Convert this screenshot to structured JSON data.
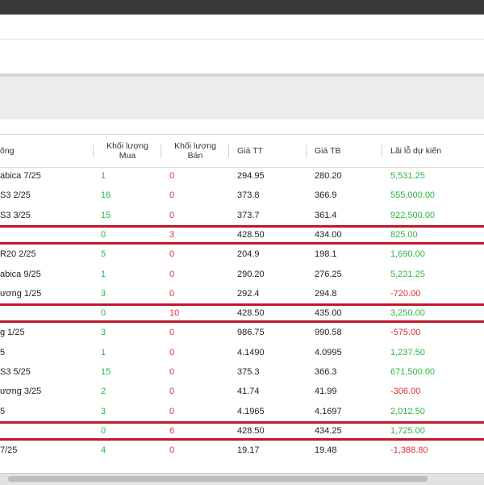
{
  "table": {
    "columns": {
      "name": "ông",
      "buy_qty": "Khối lượng\nMua",
      "sell_qty": "Khối lượng\nBán",
      "price_tt": "Giá TT",
      "price_tb": "Giá TB",
      "pnl": "Lãi lỗ dự kiến"
    },
    "rows": [
      {
        "name": "abica 7/25",
        "buy": "1",
        "sell": "0",
        "tt": "294.95",
        "tb": "280.20",
        "pnl": "5,531.25",
        "pnl_sign": "pos",
        "boxed": false
      },
      {
        "name": "S3 2/25",
        "buy": "16",
        "sell": "0",
        "tt": "373.8",
        "tb": "366.9",
        "pnl": "555,000.00",
        "pnl_sign": "pos",
        "boxed": false
      },
      {
        "name": "S3 3/25",
        "buy": "15",
        "sell": "0",
        "tt": "373.7",
        "tb": "361.4",
        "pnl": "922,500.00",
        "pnl_sign": "pos",
        "boxed": false
      },
      {
        "name": "",
        "buy": "0",
        "sell": "3",
        "tt": "428.50",
        "tb": "434.00",
        "pnl": "825.00",
        "pnl_sign": "pos",
        "boxed": true
      },
      {
        "name": "R20 2/25",
        "buy": "5",
        "sell": "0",
        "tt": "204.9",
        "tb": "198.1",
        "pnl": "1,690.00",
        "pnl_sign": "pos",
        "boxed": false
      },
      {
        "name": "abica 9/25",
        "buy": "1",
        "sell": "0",
        "tt": "290.20",
        "tb": "276.25",
        "pnl": "5,231.25",
        "pnl_sign": "pos",
        "boxed": false
      },
      {
        "name": "ương 1/25",
        "buy": "3",
        "sell": "0",
        "tt": "292.4",
        "tb": "294.8",
        "pnl": "-720.00",
        "pnl_sign": "neg",
        "boxed": false
      },
      {
        "name": "",
        "buy": "0",
        "sell": "10",
        "tt": "428.50",
        "tb": "435.00",
        "pnl": "3,250.00",
        "pnl_sign": "pos",
        "boxed": true
      },
      {
        "name": "g 1/25",
        "buy": "3",
        "sell": "0",
        "tt": "986.75",
        "tb": "990.58",
        "pnl": "-575.00",
        "pnl_sign": "neg",
        "boxed": false
      },
      {
        "name": "5",
        "buy": "1",
        "sell": "0",
        "tt": "4.1490",
        "tb": "4.0995",
        "pnl": "1,237.50",
        "pnl_sign": "pos",
        "boxed": false
      },
      {
        "name": "S3 5/25",
        "buy": "15",
        "sell": "0",
        "tt": "375.3",
        "tb": "366.3",
        "pnl": "671,500.00",
        "pnl_sign": "pos",
        "boxed": false
      },
      {
        "name": "ương 3/25",
        "buy": "2",
        "sell": "0",
        "tt": "41.74",
        "tb": "41.99",
        "pnl": "-306.00",
        "pnl_sign": "neg",
        "boxed": false
      },
      {
        "name": "5",
        "buy": "3",
        "sell": "0",
        "tt": "4.1965",
        "tb": "4.1697",
        "pnl": "2,012.50",
        "pnl_sign": "pos",
        "boxed": false
      },
      {
        "name": "",
        "buy": "0",
        "sell": "6",
        "tt": "428.50",
        "tb": "434.25",
        "pnl": "1,725.00",
        "pnl_sign": "pos",
        "boxed": true
      },
      {
        "name": " 7/25",
        "buy": "4",
        "sell": "0",
        "tt": "19.17",
        "tb": "19.48",
        "pnl": "-1,388.80",
        "pnl_sign": "neg",
        "boxed": false
      }
    ]
  },
  "colors": {
    "positive": "#2fb344",
    "negative": "#e03030",
    "highlight_border": "#c0182a"
  }
}
